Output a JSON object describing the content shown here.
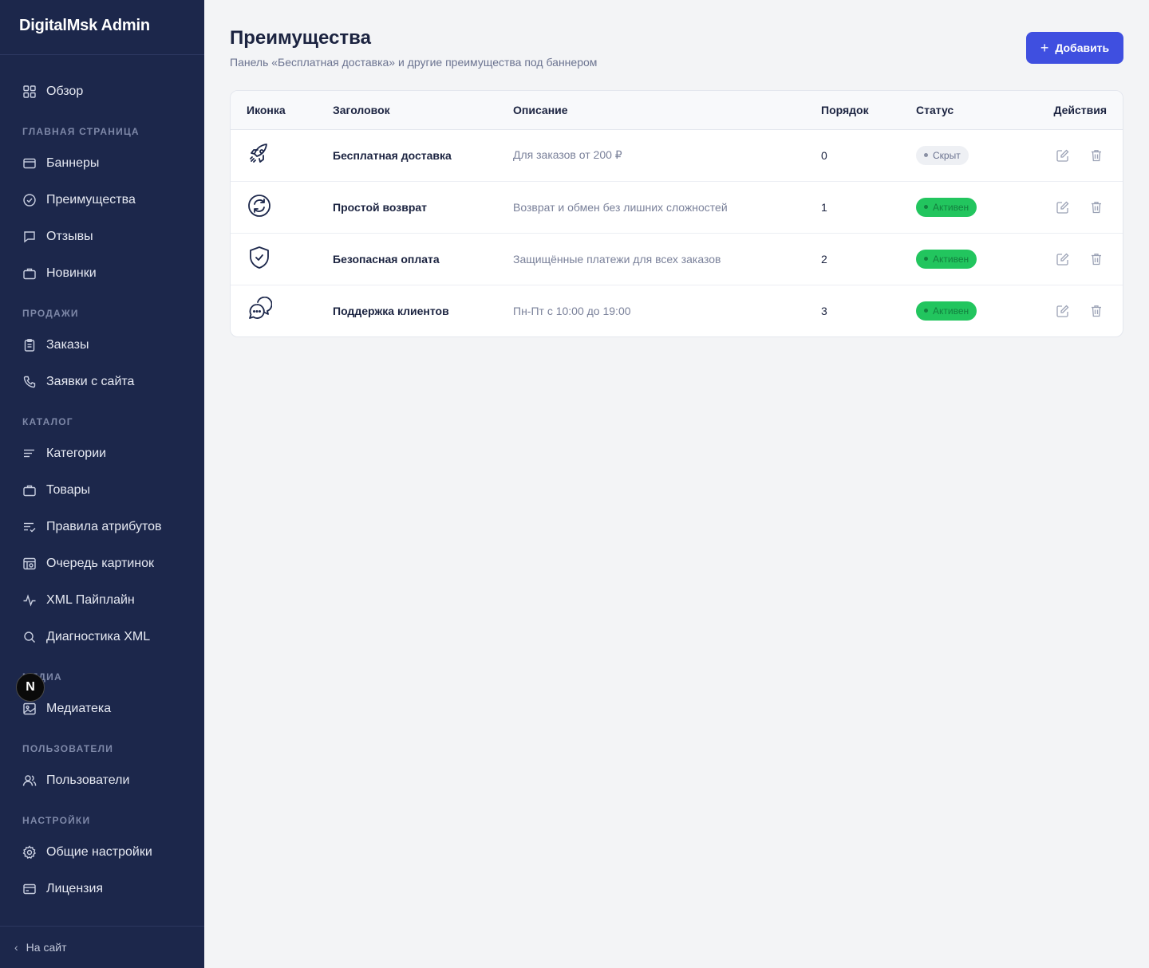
{
  "sidebar": {
    "brand": "DigitalMsk Admin",
    "overview": "Обзор",
    "sections": {
      "home": "ГЛАВНАЯ СТРАНИЦА",
      "sales": "ПРОДАЖИ",
      "catalog": "КАТАЛОГ",
      "media": "МЕДИА",
      "users": "ПОЛЬЗОВАТЕЛИ",
      "settings": "НАСТРОЙКИ"
    },
    "items": {
      "banners": "Баннеры",
      "benefits": "Преимущества",
      "reviews": "Отзывы",
      "new": "Новинки",
      "orders": "Заказы",
      "requests": "Заявки с сайта",
      "categories": "Категории",
      "products": "Товары",
      "attr_rules": "Правила атрибутов",
      "image_queue": "Очередь картинок",
      "xml_pipeline": "XML Пайплайн",
      "xml_diag": "Диагностика XML",
      "media_library": "Медиатека",
      "users": "Пользователи",
      "general_settings": "Общие настройки",
      "license": "Лицензия"
    },
    "footer": "На сайт",
    "badge_letter": "N"
  },
  "page": {
    "title": "Преимущества",
    "subtitle": "Панель «Бесплатная доставка» и другие преимущества под баннером",
    "add_label": "Добавить"
  },
  "table": {
    "headers": {
      "icon": "Иконка",
      "title": "Заголовок",
      "description": "Описание",
      "order": "Порядок",
      "status": "Статус",
      "actions": "Действия"
    },
    "rows": [
      {
        "icon": "rocket-icon",
        "title": "Бесплатная доставка",
        "description": "Для заказов от 200 ₽",
        "order": "0",
        "status": "Скрыт"
      },
      {
        "icon": "refresh-circle-icon",
        "title": "Простой возврат",
        "description": "Возврат и обмен без лишних сложностей",
        "order": "1",
        "status": "Активен"
      },
      {
        "icon": "shield-check-icon",
        "title": "Безопасная оплата",
        "description": "Защищённые платежи для всех заказов",
        "order": "2",
        "status": "Активен"
      },
      {
        "icon": "chat-bubbles-icon",
        "title": "Поддержка клиентов",
        "description": "Пн-Пт с 10:00 до 19:00",
        "order": "3",
        "status": "Активен"
      }
    ]
  },
  "colors": {
    "sidebar_bg": "#1c274b",
    "accent": "#3f4fe0",
    "active_badge": "#22c55e"
  }
}
